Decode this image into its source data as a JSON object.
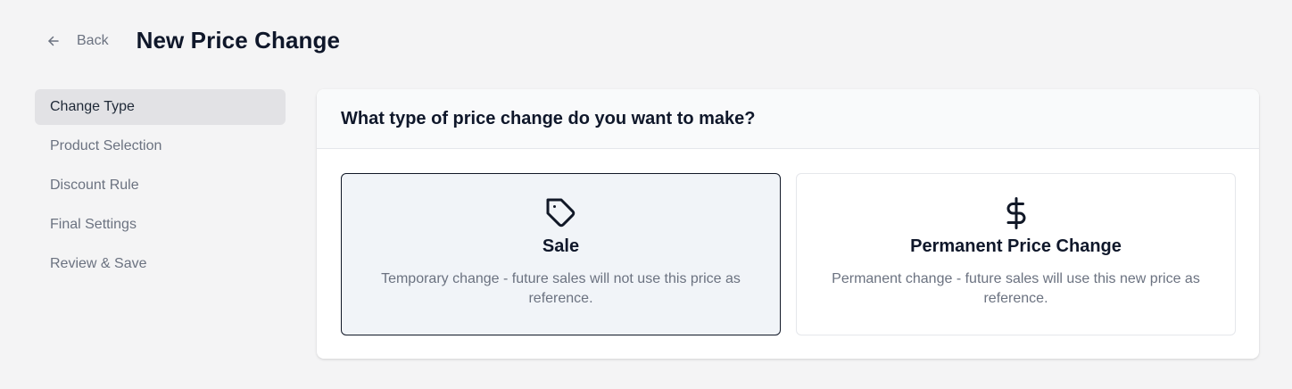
{
  "header": {
    "back_label": "Back",
    "title": "New Price Change"
  },
  "sidebar": {
    "steps": [
      {
        "label": "Change Type",
        "active": true
      },
      {
        "label": "Product Selection",
        "active": false
      },
      {
        "label": "Discount Rule",
        "active": false
      },
      {
        "label": "Final Settings",
        "active": false
      },
      {
        "label": "Review & Save",
        "active": false
      }
    ]
  },
  "card": {
    "title": "What type of price change do you want to make?",
    "options": [
      {
        "icon": "tag-icon",
        "title": "Sale",
        "description": "Temporary change - future sales will not use this price as reference.",
        "selected": true
      },
      {
        "icon": "dollar-icon",
        "title": "Permanent Price Change",
        "description": "Permanent change - future sales will use this new price as reference.",
        "selected": false
      }
    ]
  },
  "colors": {
    "background": "#f4f4f5",
    "active_step": "#e2e2e5",
    "selected_option_bg": "#f1f4f8",
    "selected_option_border": "#111827",
    "muted_text": "#6b7280"
  }
}
